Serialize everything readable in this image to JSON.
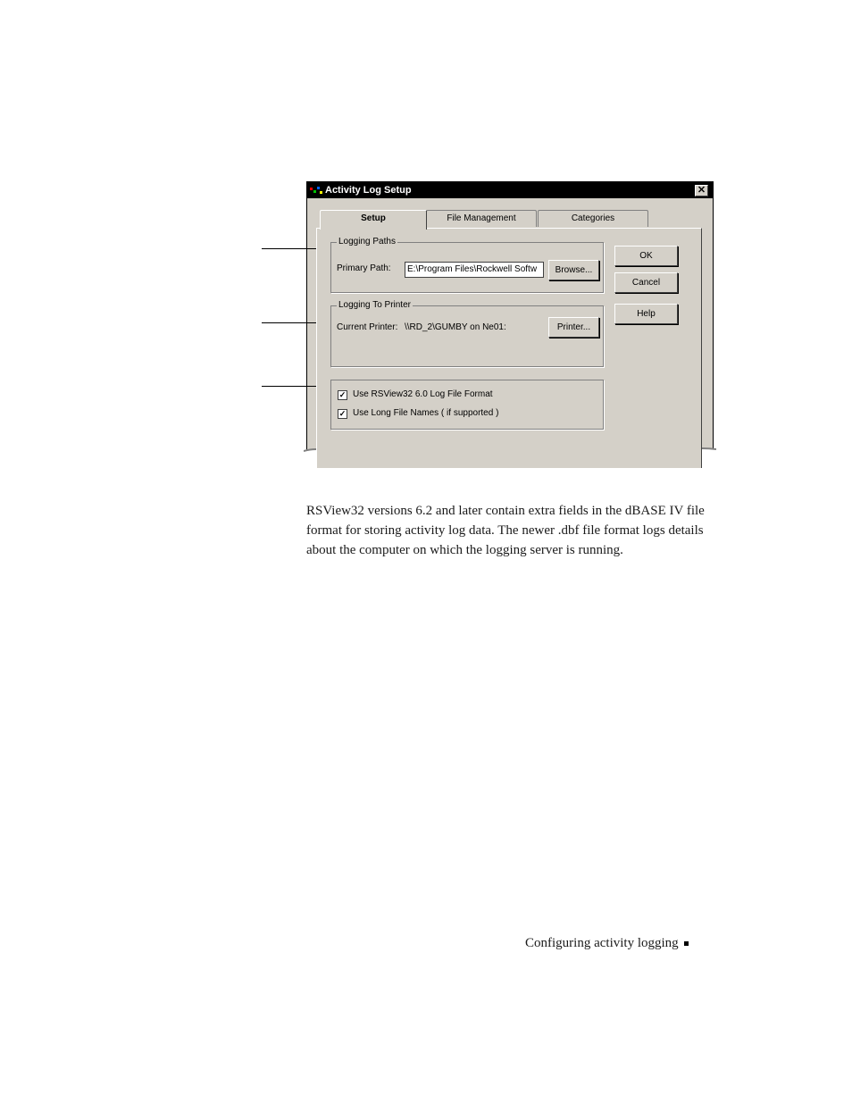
{
  "dialog": {
    "title": "Activity Log Setup",
    "close_glyph": "✕",
    "tabs": [
      {
        "label": "Setup",
        "active": true
      },
      {
        "label": "File Management",
        "active": false
      },
      {
        "label": "Categories",
        "active": false
      }
    ],
    "logging_paths": {
      "group_title": "Logging Paths",
      "primary_path_label": "Primary Path:",
      "primary_path_value": "E:\\Program Files\\Rockwell Softw",
      "browse_label": "Browse..."
    },
    "logging_to_printer": {
      "group_title": "Logging To Printer",
      "current_printer_label": "Current Printer:",
      "current_printer_value": "\\\\RD_2\\GUMBY on Ne01:",
      "printer_label": "Printer..."
    },
    "options": {
      "use_rsview_format": {
        "label": "Use RSView32 6.0 Log File Format",
        "checked": true,
        "mark": "✓"
      },
      "use_long_names": {
        "label": "Use Long File Names ( if supported )",
        "checked": true,
        "mark": "✓"
      }
    },
    "buttons": {
      "ok": "OK",
      "cancel": "Cancel",
      "help": "Help"
    }
  },
  "body_text": "RSView32 versions 6.2 and later contain extra fields in the dBASE IV file format for storing activity log data. The newer .dbf file format logs details about the computer on which the logging server is running.",
  "footer": {
    "text": "Configuring activity logging"
  }
}
